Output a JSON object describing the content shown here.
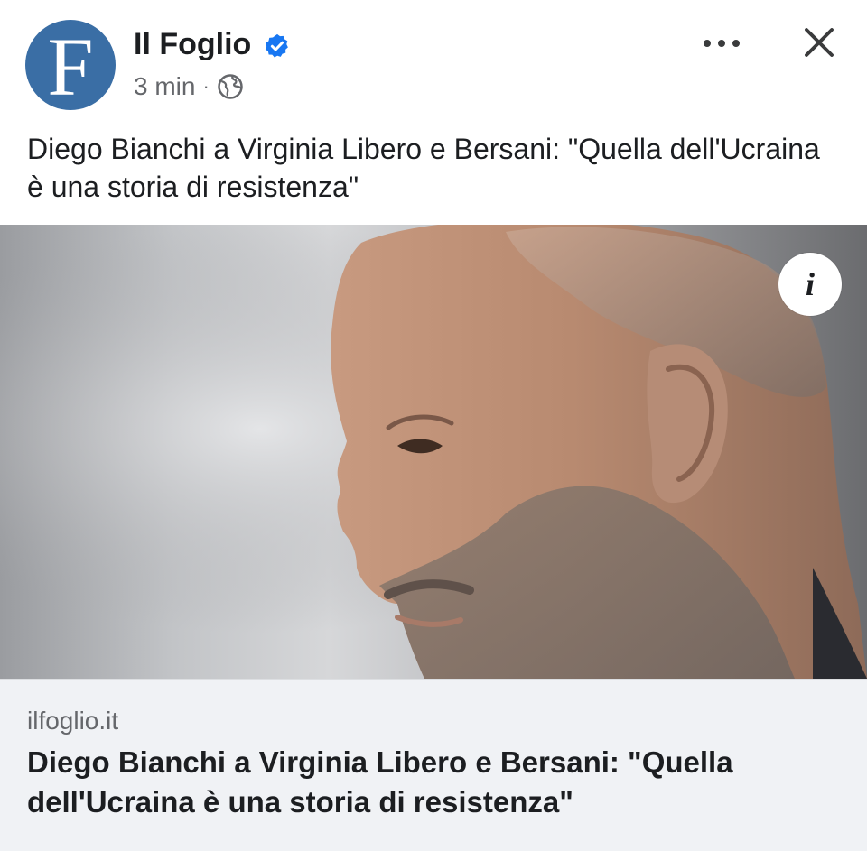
{
  "header": {
    "page_name": "Il Foglio",
    "avatar_letter": "F",
    "time": "3 min",
    "separator": "·"
  },
  "post": {
    "text": "Diego Bianchi a Virginia Libero e Bersani: \"Quella dell'Ucraina è una storia di resistenza\""
  },
  "image": {
    "info_glyph": "i"
  },
  "link_preview": {
    "domain": "ilfoglio.it",
    "title": "Diego Bianchi a Virginia Libero e Bersani: \"Quella dell'Ucraina è una storia di resistenza\""
  },
  "colors": {
    "avatar_bg": "#3a6ea5",
    "verified_blue": "#1877f2",
    "text_primary": "#1c1e21",
    "text_secondary": "#65676b",
    "link_footer_bg": "#f0f2f5"
  },
  "icons": {
    "verified": "verified-badge-icon",
    "audience": "globe-icon",
    "more": "more-options-icon",
    "close": "close-icon",
    "info": "info-icon"
  }
}
